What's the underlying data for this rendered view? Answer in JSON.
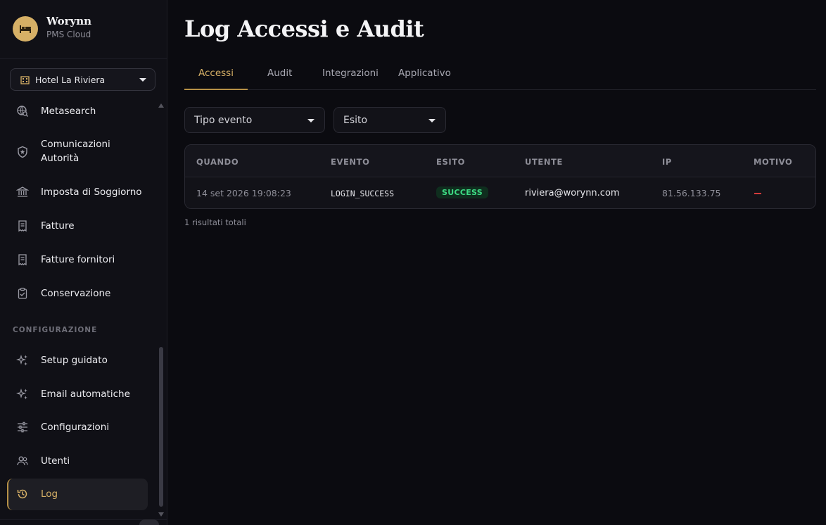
{
  "brand": {
    "name": "Worynn",
    "subtitle": "PMS Cloud",
    "logo_icon": "bed-icon",
    "accent": "#d6b066"
  },
  "hotel_selector": {
    "value": "Hotel La Riviera",
    "icon": "building-icon"
  },
  "sidebar": {
    "items": [
      {
        "label": "Metasearch",
        "icon": "globe-search-icon"
      },
      {
        "label": "Comunicazioni\nAutorità",
        "label_line1": "Comunicazioni",
        "label_line2": "Autorità",
        "icon": "shield-star-icon"
      },
      {
        "label": "Imposta di Soggiorno",
        "icon": "bank-icon"
      },
      {
        "label": "Fatture",
        "icon": "receipt-icon"
      },
      {
        "label": "Fatture fornitori",
        "icon": "receipt-icon"
      },
      {
        "label": "Conservazione",
        "icon": "clipboard-check-icon"
      }
    ],
    "section_config": "CONFIGURAZIONE",
    "config_items": [
      {
        "label": "Setup guidato",
        "icon": "sparkle-icon"
      },
      {
        "label": "Email automatiche",
        "icon": "sparkle-icon"
      },
      {
        "label": "Configurazioni",
        "icon": "sliders-icon"
      },
      {
        "label": "Utenti",
        "icon": "users-icon"
      },
      {
        "label": "Log",
        "icon": "history-icon",
        "active": true
      }
    ]
  },
  "page": {
    "title": "Log Accessi e Audit"
  },
  "tabs": [
    {
      "label": "Accessi",
      "active": true
    },
    {
      "label": "Audit"
    },
    {
      "label": "Integrazioni"
    },
    {
      "label": "Applicativo"
    }
  ],
  "filters": {
    "event_type": {
      "value": "Tipo evento"
    },
    "outcome": {
      "value": "Esito"
    }
  },
  "table": {
    "columns": [
      "QUANDO",
      "EVENTO",
      "ESITO",
      "UTENTE",
      "IP",
      "MOTIVO"
    ],
    "rows": [
      {
        "when": "14 set 2026 19:08:23",
        "event": "LOGIN_SUCCESS",
        "outcome": "SUCCESS",
        "user": "riviera@worynn.com",
        "ip": "81.56.133.75",
        "reason": "—"
      }
    ]
  },
  "results_text": "1 risultati totali",
  "colors": {
    "success_bg": "#0f2e1e",
    "success_fg": "#3ddc84",
    "danger": "#d23b3b",
    "active_accent": "#b79147"
  }
}
